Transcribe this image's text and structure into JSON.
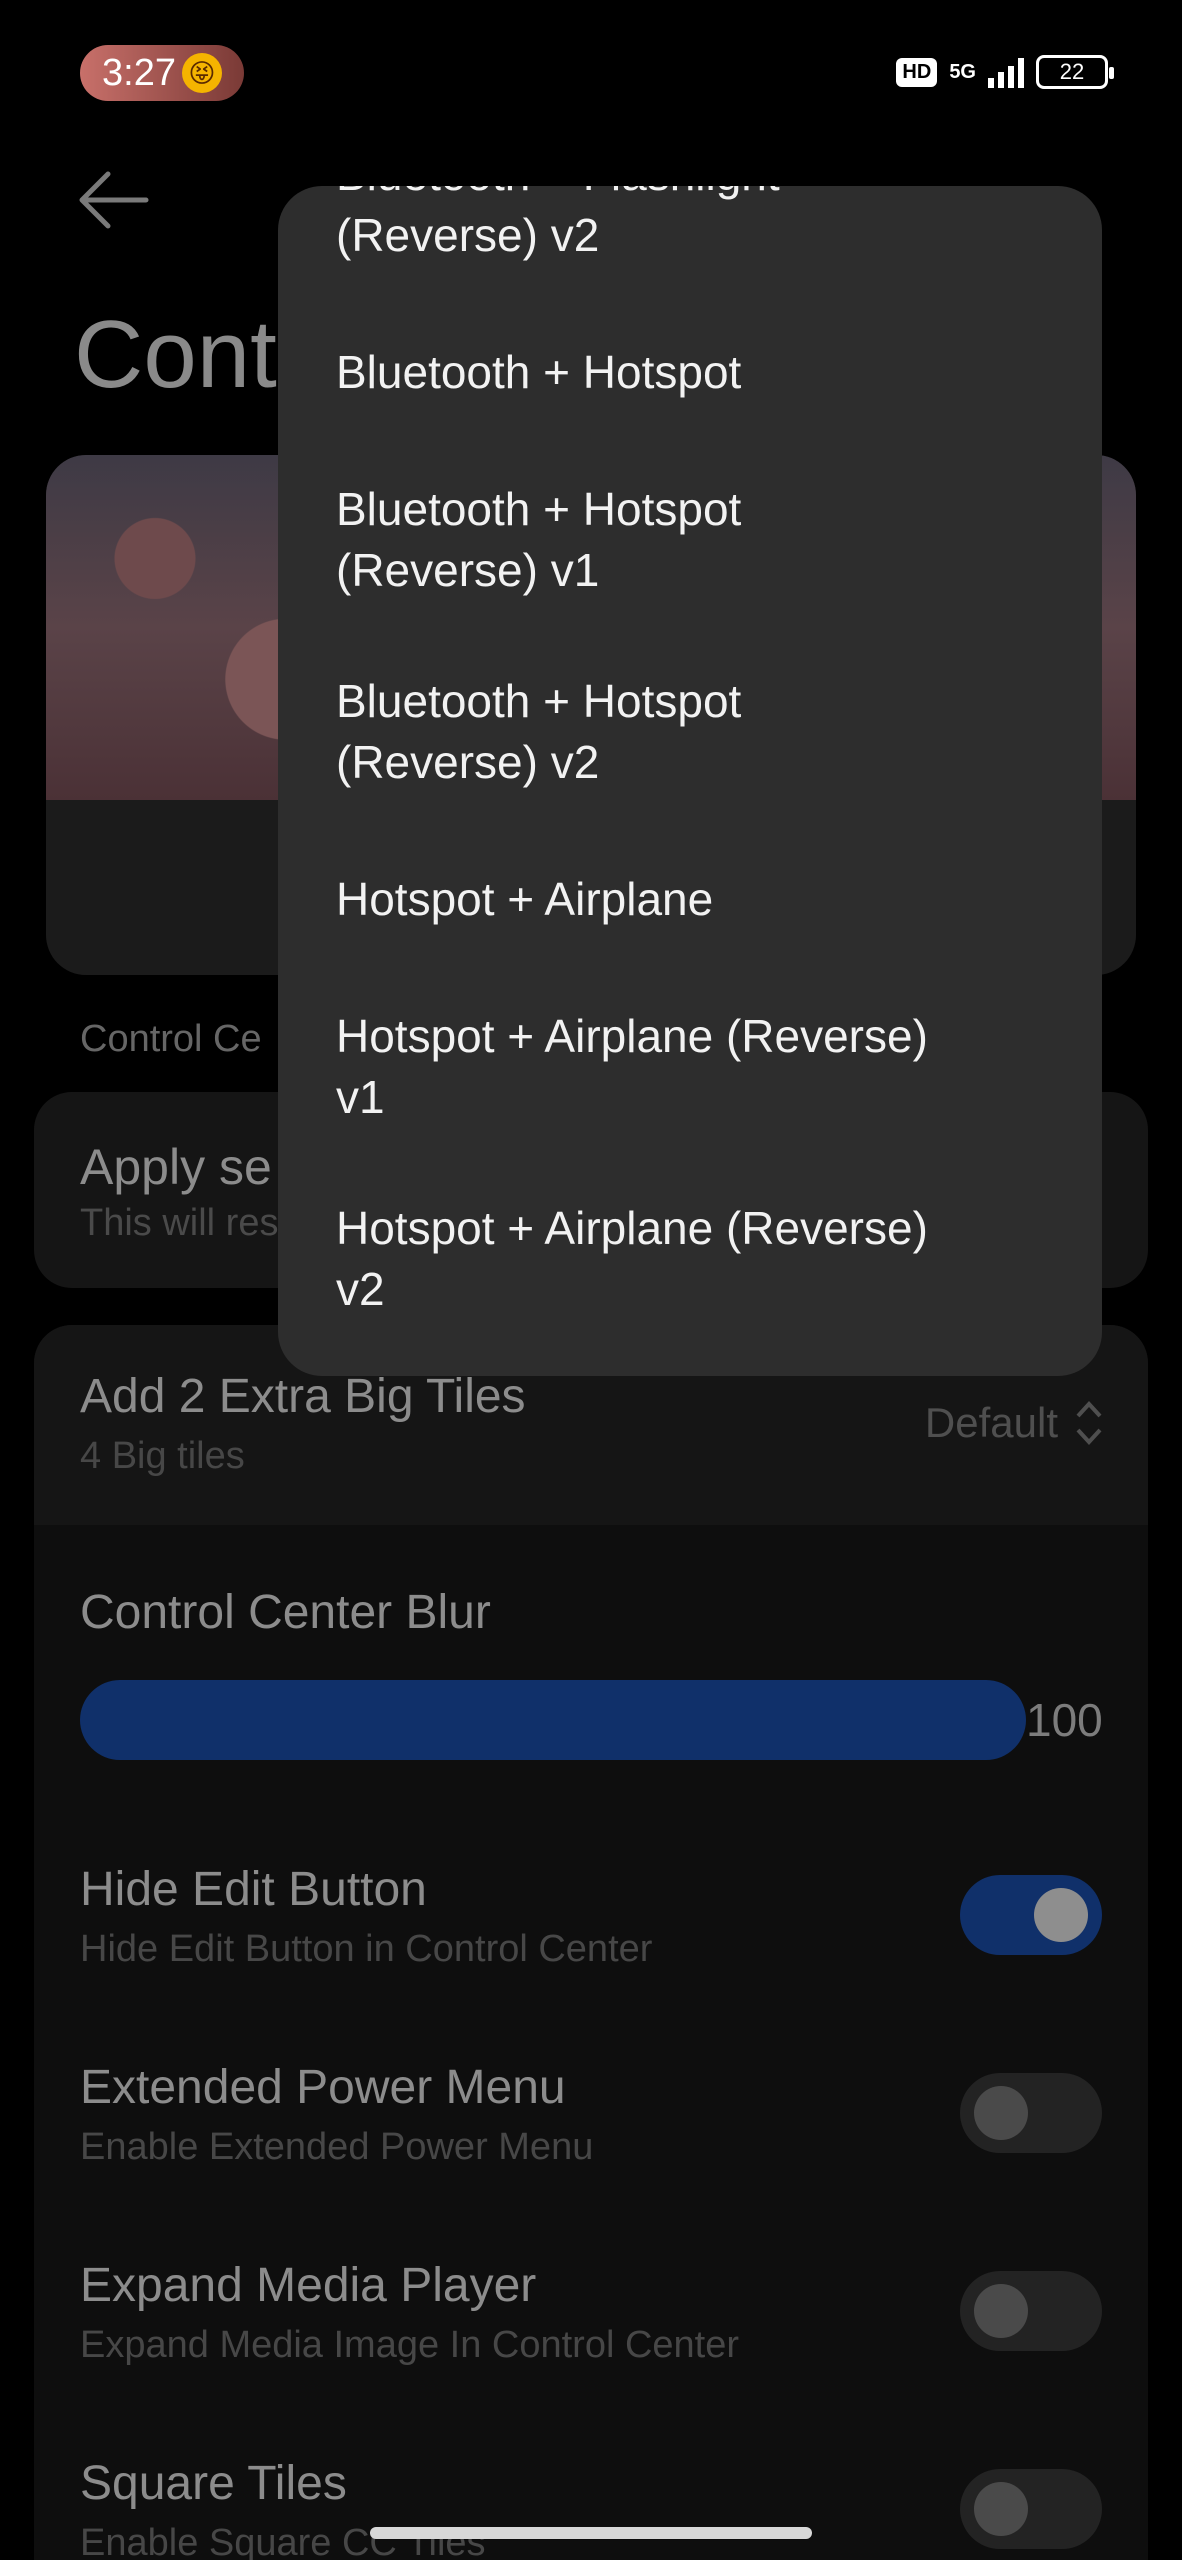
{
  "status_bar": {
    "time": "3:27",
    "emoji": "😝",
    "hd_badge": "HD",
    "network": "5G",
    "battery": "22"
  },
  "header": {
    "back_icon": "arrow-left-icon",
    "title": "Cont"
  },
  "section_label": "Control Ce",
  "apply_card": {
    "title": "Apply se",
    "subtitle": "This will res"
  },
  "settings": {
    "big_tiles": {
      "title": "Add 2 Extra Big Tiles",
      "subtitle": "4 Big tiles",
      "value": "Default"
    },
    "blur": {
      "title": "Control Center Blur",
      "value": "100",
      "level_percent": 100
    },
    "toggles": [
      {
        "title": "Hide Edit Button",
        "subtitle": "Hide Edit Button in Control Center",
        "on": true
      },
      {
        "title": "Extended Power Menu",
        "subtitle": "Enable Extended Power Menu",
        "on": false
      },
      {
        "title": "Expand Media Player",
        "subtitle": "Expand Media Image In Control Center",
        "on": false
      },
      {
        "title": "Square Tiles",
        "subtitle": "Enable Square CC Tiles",
        "on": false
      }
    ]
  },
  "popup_menu": {
    "items": [
      {
        "line1": "Bluetooth + Flashlight",
        "line2": "(Reverse) v2"
      },
      {
        "line1": "Bluetooth + Hotspot",
        "line2": ""
      },
      {
        "line1": "Bluetooth + Hotspot",
        "line2": "(Reverse) v1"
      },
      {
        "line1": "Bluetooth + Hotspot",
        "line2": "(Reverse) v2"
      },
      {
        "line1": "Hotspot + Airplane",
        "line2": ""
      },
      {
        "line1": "Hotspot + Airplane (Reverse)",
        "line2": "v1"
      },
      {
        "line1": "Hotspot + Airplane (Reverse)",
        "line2": "v2"
      }
    ]
  },
  "colors": {
    "accent": "#10306a",
    "popup_bg": "#2d2d2d",
    "background": "#000000"
  }
}
